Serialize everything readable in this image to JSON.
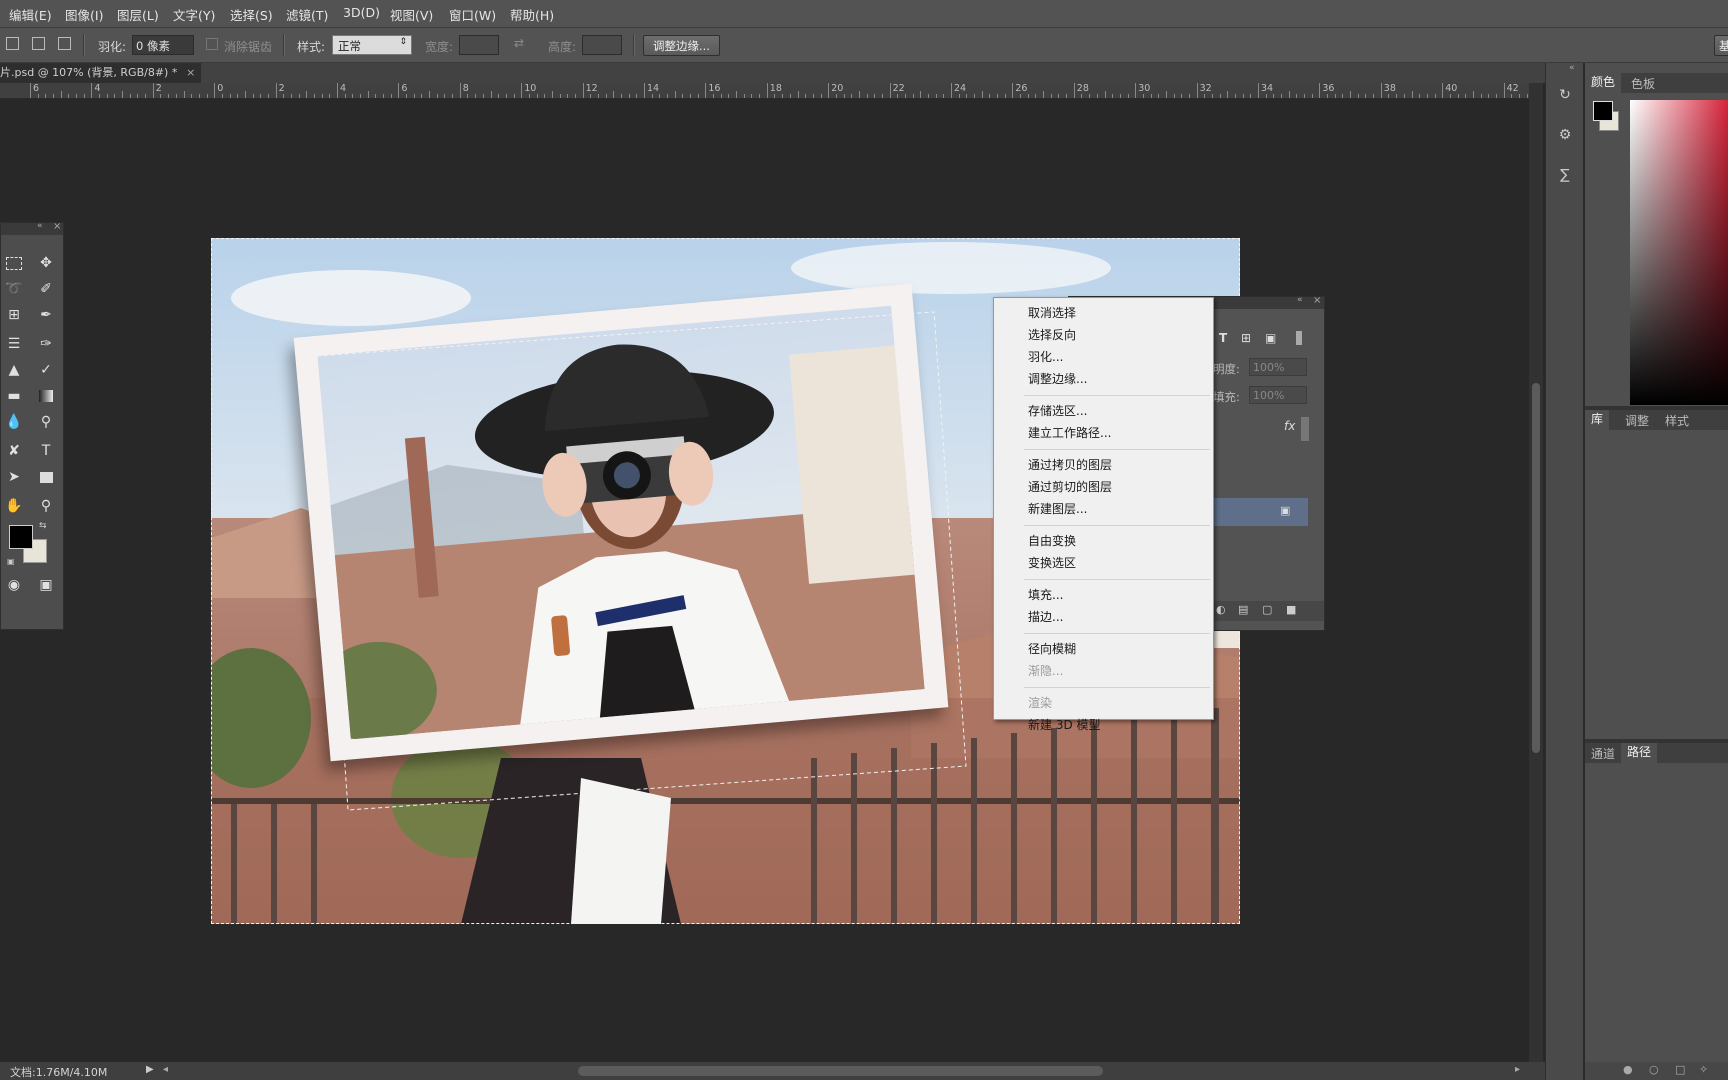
{
  "menubar": {
    "items": [
      "编辑(E)",
      "图像(I)",
      "图层(L)",
      "文字(Y)",
      "选择(S)",
      "滤镜(T)",
      "3D(D)",
      "视图(V)",
      "窗口(W)",
      "帮助(H)"
    ]
  },
  "options": {
    "feather_label": "羽化:",
    "feather_value": "0 像素",
    "antialias_label": "消除锯齿",
    "style_label": "样式:",
    "style_value": "正常",
    "width_label": "宽度:",
    "height_label": "高度:",
    "refine_edge_button": "调整边缘...",
    "right_edge_button": "基"
  },
  "document": {
    "tab_title": "片.psd @ 107% (背景, RGB/8#) *",
    "status": "文档:1.76M/4.10M"
  },
  "ruler": {
    "labels": [
      "6",
      "4",
      "2",
      "0",
      "2",
      "4",
      "6",
      "8",
      "10",
      "12",
      "14",
      "16",
      "18",
      "20",
      "22",
      "24",
      "26",
      "28",
      "30",
      "32",
      "34",
      "36",
      "38",
      "40",
      "42"
    ]
  },
  "panels": {
    "color_tabs": [
      "颜色",
      "色板"
    ],
    "library_tabs": [
      "库",
      "调整",
      "样式"
    ],
    "channel_tabs": [
      "通道",
      "路径"
    ]
  },
  "layers_panel": {
    "opacity_label": "明度:",
    "opacity_value": "100%",
    "fill_label": "填充:",
    "fill_value": "100%",
    "fx_label": "fx"
  },
  "context_menu": {
    "groups": [
      [
        {
          "label": "取消选择",
          "enabled": true
        },
        {
          "label": "选择反向",
          "enabled": true
        },
        {
          "label": "羽化...",
          "enabled": true
        },
        {
          "label": "调整边缘...",
          "enabled": true
        }
      ],
      [
        {
          "label": "存储选区...",
          "enabled": true
        },
        {
          "label": "建立工作路径...",
          "enabled": true
        }
      ],
      [
        {
          "label": "通过拷贝的图层",
          "enabled": true
        },
        {
          "label": "通过剪切的图层",
          "enabled": true
        },
        {
          "label": "新建图层...",
          "enabled": true
        }
      ],
      [
        {
          "label": "自由变换",
          "enabled": true
        },
        {
          "label": "变换选区",
          "enabled": true
        }
      ],
      [
        {
          "label": "填充...",
          "enabled": true
        },
        {
          "label": "描边...",
          "enabled": true
        }
      ],
      [
        {
          "label": "径向模糊",
          "enabled": true
        },
        {
          "label": "渐隐...",
          "enabled": false
        }
      ],
      [
        {
          "label": "渲染",
          "enabled": false
        },
        {
          "label": "新建 3D 模型",
          "enabled": true
        }
      ]
    ]
  },
  "colors": {
    "foreground": "#000000",
    "background": "#e8e4d8"
  }
}
